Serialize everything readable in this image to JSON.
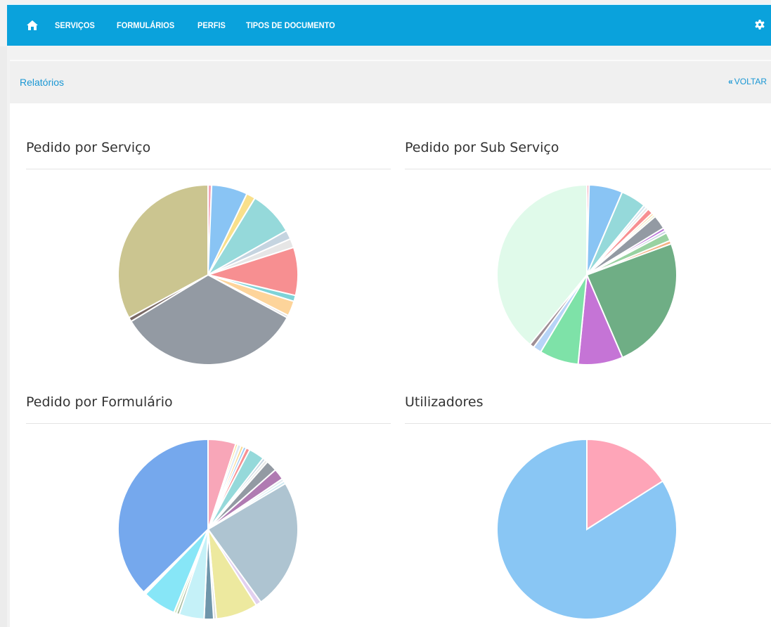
{
  "nav": {
    "items": [
      {
        "label": "SERVIÇOS"
      },
      {
        "label": "FORMULÁRIOS"
      },
      {
        "label": "PERFIS"
      },
      {
        "label": "TIPOS DE DOCUMENTO"
      }
    ],
    "home_icon": "home-icon",
    "settings_icon": "gear-icon"
  },
  "panel": {
    "title": "Relatórios",
    "back_label": "VOLTAR",
    "back_icon": "double-chevron-left-icon"
  },
  "colors": {
    "navbar": "#0aa2dc",
    "link": "#1a97d4"
  },
  "chart_data": [
    {
      "type": "pie",
      "title": "Pedido por Serviço",
      "values": [
        0.6,
        6.0,
        1.5,
        7.5,
        1.5,
        1.5,
        8.0,
        1.0,
        2.5,
        0.4,
        31.0,
        0.7,
        30.5
      ],
      "colors": [
        "#f4a6b8",
        "#89c4f4",
        "#f9e08b",
        "#95d9da",
        "#c5d4e0",
        "#e6e6e6",
        "#f78f91",
        "#7ed3d8",
        "#fdd49a",
        "#e0e0e0",
        "#939aa3",
        "#7a6a66",
        "#cbc590"
      ]
    },
    {
      "type": "pie",
      "title": "Pedido por Sub Serviço",
      "values": [
        0.4,
        6.0,
        4.5,
        0.5,
        0.5,
        1.0,
        0.4,
        0.4,
        2.5,
        0.5,
        0.5,
        1.5,
        0.6,
        24.0,
        8.0,
        7.0,
        1.5,
        0.8,
        38.9
      ],
      "colors": [
        "#f4a6b8",
        "#89c4f4",
        "#95d9da",
        "#cfe6f0",
        "#e6e6e6",
        "#f78f91",
        "#fdd49a",
        "#e8f0c8",
        "#939aa3",
        "#b56ad6",
        "#c5d4e0",
        "#99d2a1",
        "#f4b183",
        "#6fae85",
        "#c574d6",
        "#7ee2a8",
        "#b7d4f7",
        "#9f8e95",
        "#e0faea"
      ]
    },
    {
      "type": "pie",
      "title": "Pedido por Formulário",
      "values": [
        5.0,
        0.4,
        0.6,
        0.5,
        0.5,
        0.7,
        2.8,
        0.5,
        0.5,
        2.0,
        2.0,
        0.5,
        0.5,
        23.5,
        1.0,
        7.5,
        0.5,
        1.7,
        4.5,
        0.5,
        0.5,
        6.0,
        0.5,
        37.3
      ],
      "colors": [
        "#f8a6b8",
        "#f9e08b",
        "#dbe9f3",
        "#f9d98e",
        "#9ecaf6",
        "#f78f91",
        "#95d9da",
        "#c5d4e0",
        "#e6e6e6",
        "#939aa3",
        "#b07bb2",
        "#dfe8ee",
        "#cfeaf2",
        "#aec4d1",
        "#e2d0ef",
        "#ede99f",
        "#d9dcdc",
        "#6f96ab",
        "#c5f1f8",
        "#a5b99b",
        "#d6ecc4",
        "#87e6f7",
        "#ffffff",
        "#75a8ed"
      ]
    },
    {
      "type": "pie",
      "title": "Utilizadores",
      "values": [
        16,
        84
      ],
      "colors": [
        "#fea5b8",
        "#89c6f4"
      ]
    }
  ]
}
